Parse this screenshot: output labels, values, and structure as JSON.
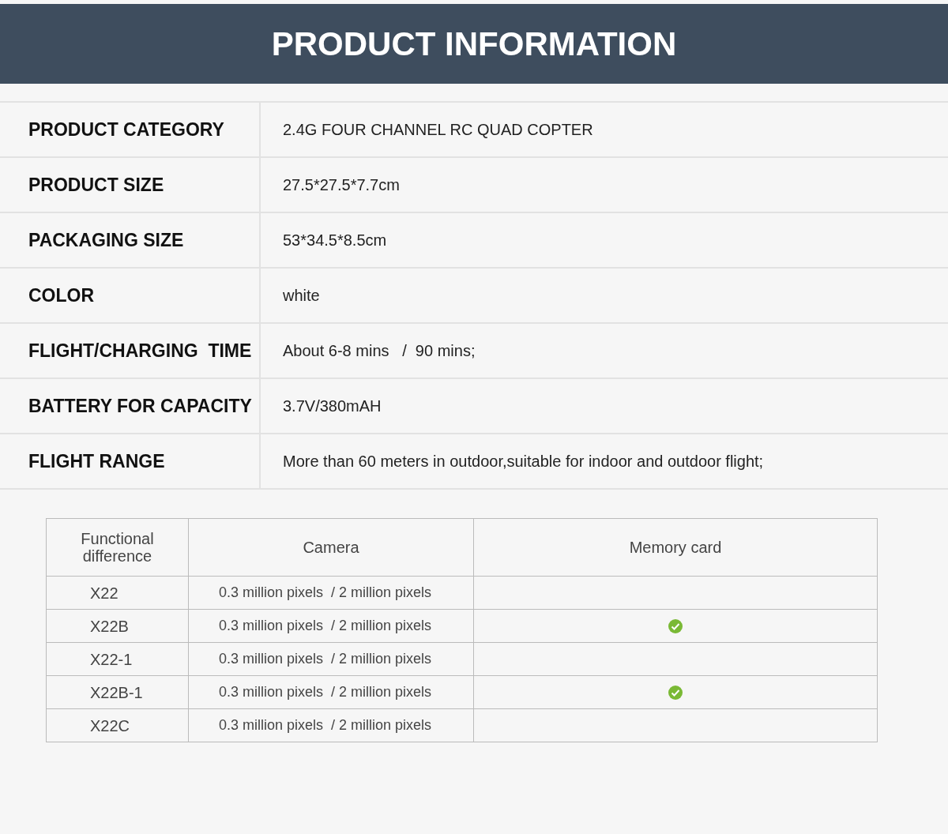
{
  "title": "PRODUCT INFORMATION",
  "specs": [
    {
      "label": "PRODUCT CATEGORY",
      "value": "2.4G FOUR CHANNEL RC QUAD COPTER"
    },
    {
      "label": "PRODUCT SIZE",
      "value": "27.5*27.5*7.7cm"
    },
    {
      "label": "PACKAGING SIZE",
      "value": "53*34.5*8.5cm"
    },
    {
      "label": "COLOR",
      "value": "white"
    },
    {
      "label": "FLIGHT/CHARGING  TIME",
      "value": "About 6-8 mins   /  90 mins;"
    },
    {
      "label": "BATTERY FOR CAPACITY",
      "value": "3.7V/380mAH"
    },
    {
      "label": "FLIGHT RANGE",
      "value": "More than 60 meters in outdoor,suitable for indoor and outdoor flight;"
    }
  ],
  "comparison": {
    "columns": [
      "Functional\ndifference",
      "Camera",
      "Memory card"
    ],
    "rows": [
      {
        "model": "X22",
        "camera": "0.3 million pixels  / 2 million pixels",
        "memory_card": false
      },
      {
        "model": "X22B",
        "camera": "0.3 million pixels  / 2 million pixels",
        "memory_card": true
      },
      {
        "model": "X22-1",
        "camera": "0.3 million pixels  / 2 million pixels",
        "memory_card": false
      },
      {
        "model": "X22B-1",
        "camera": "0.3 million pixels  / 2 million pixels",
        "memory_card": true
      },
      {
        "model": "X22C",
        "camera": "0.3 million pixels  / 2 million pixels",
        "memory_card": false
      }
    ]
  }
}
